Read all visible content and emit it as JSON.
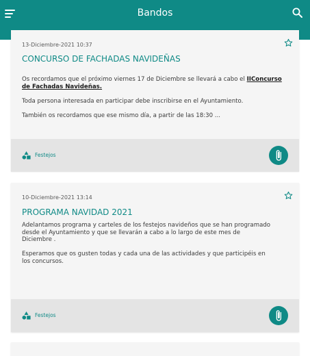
{
  "header": {
    "title": "Bandos",
    "menu_icon": "menu-icon",
    "search_icon": "search-icon"
  },
  "colors": {
    "accent": "#0f8a86",
    "card_bg": "#f5f5f5",
    "footer_bg": "#e4e4e4"
  },
  "posts": [
    {
      "date": "13-Diciembre-2021 10:37",
      "title": "CONCURSO DE FACHADAS NAVIDEÑAS",
      "body_line1": "Os recordamos que el próximo viernes 17 de Diciembre se llevará a cabo el ",
      "body_link": "IIConcurso de Fachadas Navideñas.",
      "body_p2": "Toda persona interesada en participar debe inscribirse en el Ayuntamiento.",
      "body_p3": "También os recordamos que ese mismo día, a partir de las 18:30 ...",
      "category": "Festejos",
      "category_icon": "shapes-icon",
      "attachment_icon": "paperclip-icon",
      "favorite_icon": "star-outline-icon"
    },
    {
      "date": "10-Diciembre-2021 13:14",
      "title": "PROGRAMA NAVIDAD 2021",
      "body_p1": "Adelantamos programa y carteles de los  festejos navideños que se han programado desde el Ayuntamiento y que se llevarán a cabo a lo largo de este mes de Diciembre .",
      "body_p2": "Esperamos que os gusten todas y cada una de las actividades  y que participéis en los concursos.",
      "category": "Festejos",
      "category_icon": "shapes-icon",
      "attachment_icon": "paperclip-icon",
      "favorite_icon": "star-outline-icon"
    }
  ]
}
